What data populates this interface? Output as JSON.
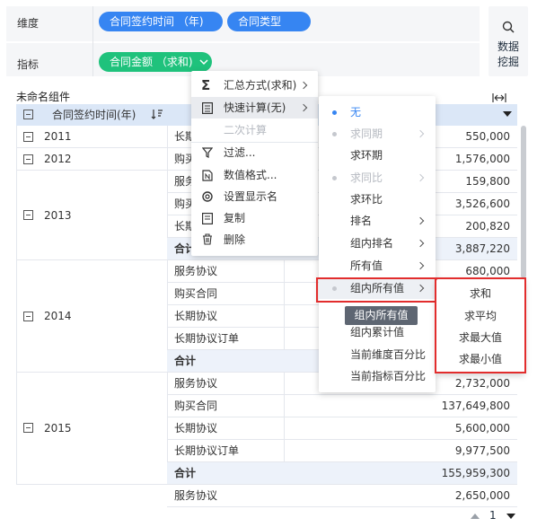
{
  "dims_label": "维度",
  "dims": [
    "合同签约时间 （年)",
    "合同类型"
  ],
  "metric_label": "指标",
  "metric": "合同金额 （求和)",
  "side_button": [
    "数据",
    "挖掘"
  ],
  "component_title": "未命名组件",
  "table": {
    "header_col1": "合同签约时间(年)",
    "years": [
      "2011",
      "2012",
      "2013",
      "2014",
      "2015"
    ],
    "rows": [
      {
        "type": "长期协",
        "value": "550,000"
      },
      {
        "type": "购买",
        "value": "1,576,000"
      },
      {
        "type": "服务",
        "value": "159,800"
      },
      {
        "type": "购买",
        "value": "3,526,600"
      },
      {
        "type": "长期",
        "value": "200,820"
      },
      {
        "type": "合计",
        "value": "3,887,220"
      },
      {
        "type": "服务协议",
        "value": "680,000"
      },
      {
        "type": "购买合同",
        "value": ""
      },
      {
        "type": "长期协议",
        "value": ""
      },
      {
        "type": "长期协议订单",
        "value": ""
      },
      {
        "type": "合计",
        "value": ""
      },
      {
        "type": "服务协议",
        "value": "2,732,000"
      },
      {
        "type": "购买合同",
        "value": "137,649,800"
      },
      {
        "type": "长期协议",
        "value": "5,600,000"
      },
      {
        "type": "长期协议订单",
        "value": "9,977,500"
      },
      {
        "type": "合计",
        "value": "155,959,300"
      },
      {
        "type": "服务协议",
        "value": "2,650,000"
      }
    ]
  },
  "menu1": {
    "items": [
      "汇总方式(求和)",
      "快速计算(无)",
      "二次计算",
      "过滤...",
      "数值格式...",
      "设置显示名",
      "复制",
      "删除"
    ]
  },
  "menu2": {
    "items": [
      "无",
      "求同期",
      "求环期",
      "求同比",
      "求环比",
      "排名",
      "组内排名",
      "所有值",
      "组内所有值",
      "组内累计值",
      "当前维度百分比",
      "当前指标百分比"
    ],
    "tooltip": "组内所有值"
  },
  "menu3": {
    "items": [
      "求和",
      "求平均",
      "求最大值",
      "求最小值"
    ]
  },
  "pager": {
    "page": "1"
  },
  "colors": {
    "accent": "#3685f2",
    "green": "#1fc27c",
    "highlight": "#e22d2d"
  }
}
